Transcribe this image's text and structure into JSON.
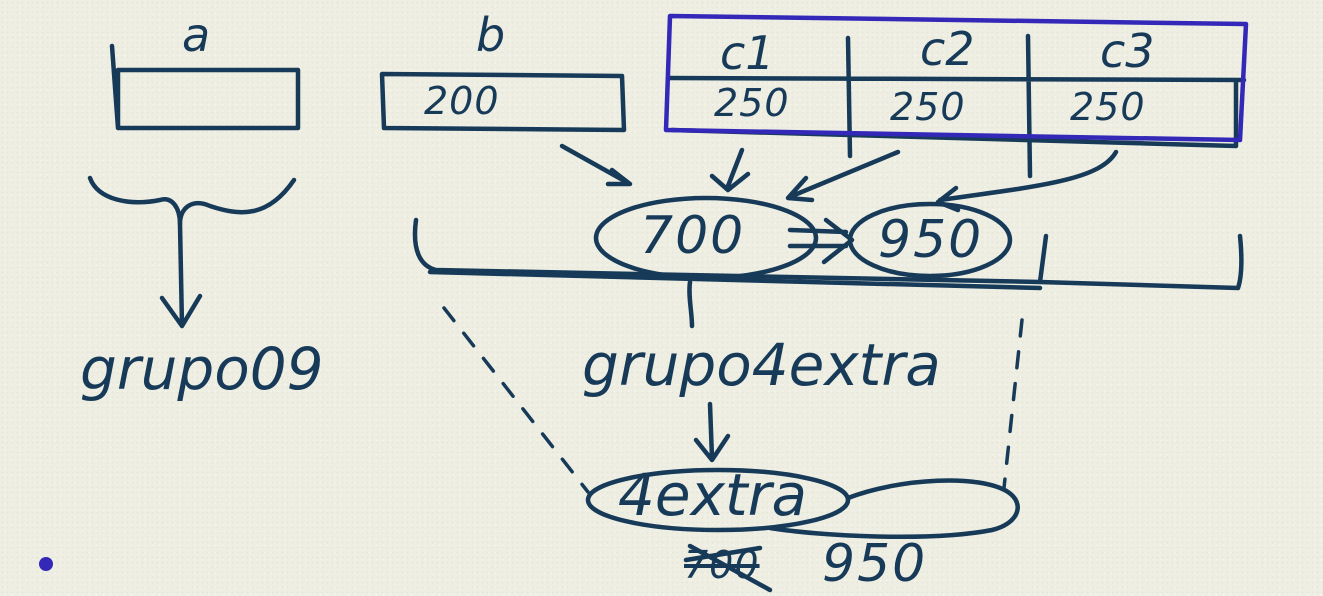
{
  "vars": {
    "a": {
      "name": "a",
      "value": ""
    },
    "b": {
      "name": "b",
      "value": "200"
    },
    "c": {
      "cells": [
        {
          "name": "c1",
          "value": "250"
        },
        {
          "name": "c2",
          "value": "250"
        },
        {
          "name": "c3",
          "value": "250"
        }
      ]
    }
  },
  "groups": {
    "grupo09": {
      "label": "grupo09"
    },
    "grupo4extra": {
      "label": "grupo4extra",
      "old_total": "700",
      "new_total": "950"
    }
  },
  "result": {
    "label": "4extra",
    "old_value": "700",
    "new_value": "950"
  },
  "colors": {
    "ink": "#163a58",
    "highlight": "#3328b8",
    "paper": "#eeeee3"
  }
}
